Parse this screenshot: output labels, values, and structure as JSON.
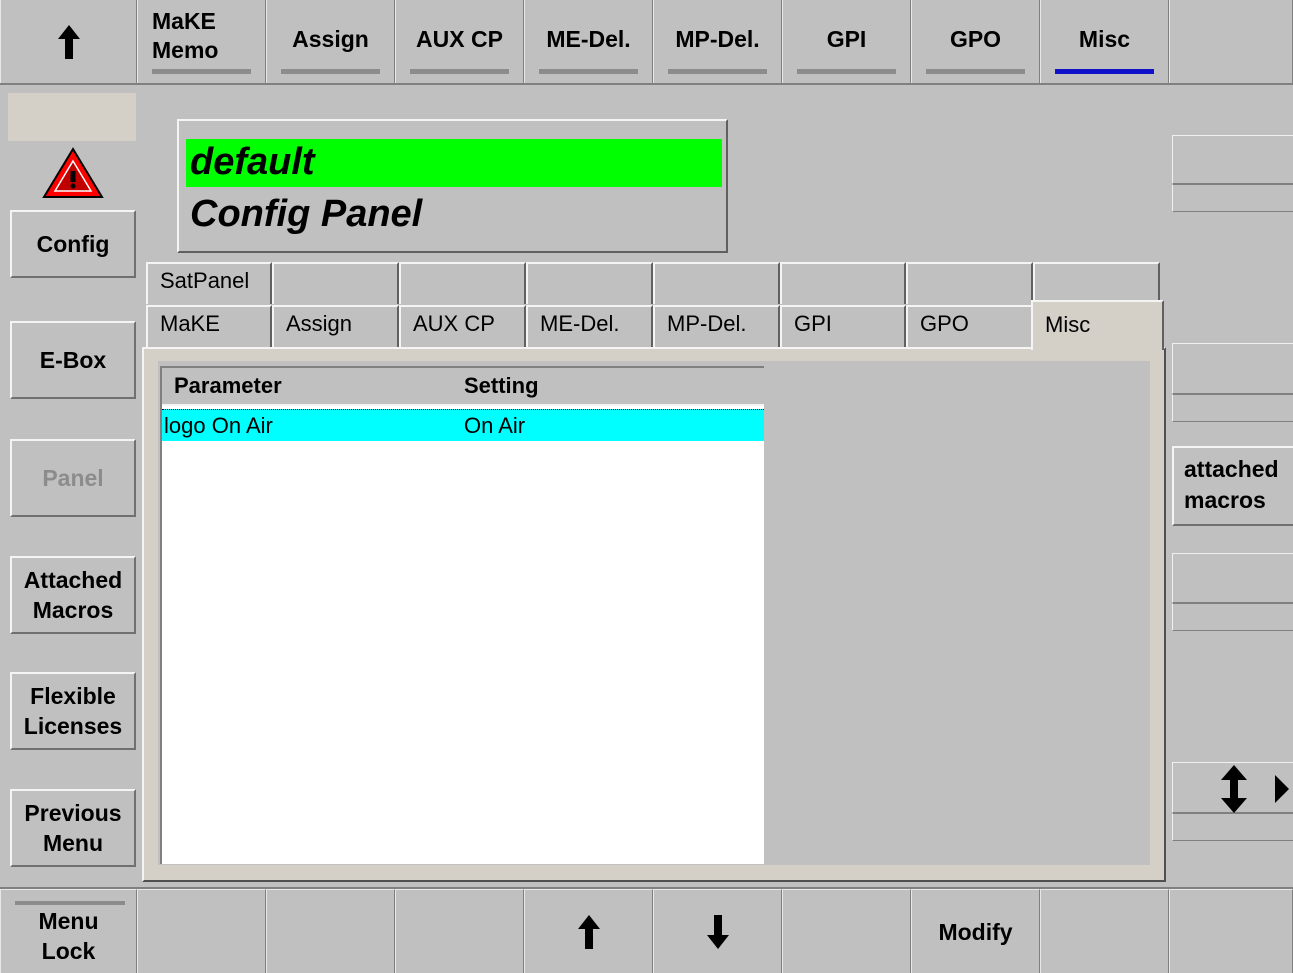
{
  "top_bar": {
    "up_icon": "up-arrow-icon",
    "tabs": [
      {
        "label": "MaKE Memo"
      },
      {
        "label": "Assign"
      },
      {
        "label": "AUX CP"
      },
      {
        "label": "ME-Del."
      },
      {
        "label": "MP-Del."
      },
      {
        "label": "GPI"
      },
      {
        "label": "GPO"
      },
      {
        "label": "Misc",
        "active": true
      }
    ]
  },
  "sidebar": {
    "warning_icon": "warning-triangle-icon",
    "buttons": [
      {
        "label": "Config"
      },
      {
        "label": "E-Box"
      },
      {
        "label": "Panel",
        "disabled": true
      },
      {
        "label": "Attached Macros"
      },
      {
        "label": "Flexible Licenses"
      },
      {
        "label": "Previous Menu"
      }
    ]
  },
  "header": {
    "name": "default",
    "title": "Config Panel",
    "name_bg": "#00ff00"
  },
  "panel_tabs": {
    "row1": [
      "SatPanel",
      "",
      "",
      "",
      "",
      "",
      "",
      ""
    ],
    "row2": [
      "MaKE",
      "Assign",
      "AUX CP",
      "ME-Del.",
      "MP-Del.",
      "GPI",
      "GPO",
      "Misc"
    ],
    "active": "Misc"
  },
  "table": {
    "columns": [
      "Parameter",
      "Setting"
    ],
    "rows": [
      {
        "parameter": "logo On Air",
        "setting": "On Air",
        "selected": true
      }
    ],
    "selection_color": "#00ffff"
  },
  "right_panel": {
    "attached_macros_label": "attached macros",
    "scroll_icon": "up-down-arrow-icon",
    "expand_icon": "right-triangle-icon"
  },
  "bottom_bar": {
    "menu_lock_label": "Menu Lock",
    "up_icon": "up-arrow-icon",
    "down_icon": "down-arrow-icon",
    "modify_label": "Modify"
  }
}
